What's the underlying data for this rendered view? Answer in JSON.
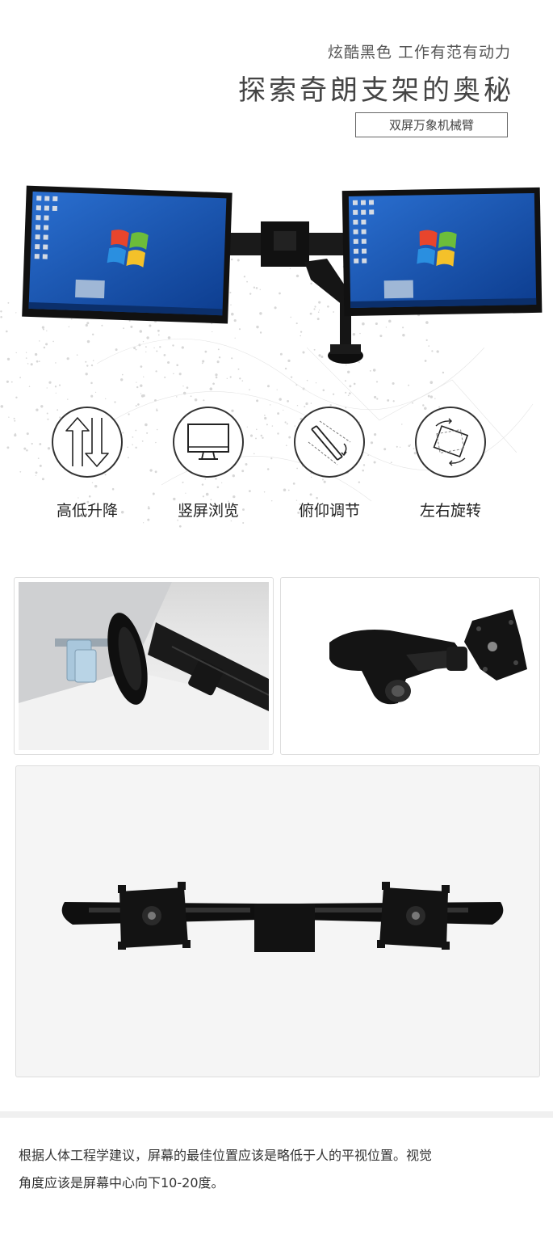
{
  "header": {
    "subtitle": "炫酷黑色 工作有范有动力",
    "title": "探索奇朗支架的奥秘",
    "tag": "双屏万象机械臂"
  },
  "features": [
    {
      "icon": "up-down-arrows-icon",
      "label": "高低升降"
    },
    {
      "icon": "monitor-icon",
      "label": "竖屏浏览"
    },
    {
      "icon": "tilt-icon",
      "label": "俯仰调节"
    },
    {
      "icon": "rotate-icon",
      "label": "左右旋转"
    }
  ],
  "photos": [
    {
      "icon": "desk-clamp-pole-photo"
    },
    {
      "icon": "gas-spring-arm-photo"
    },
    {
      "icon": "dual-crossbar-photo"
    }
  ],
  "description": {
    "line1": "根据人体工程学建议，屏幕的最佳位置应该是略低于人的平视位置。视觉",
    "line2": "角度应该是屏幕中心向下10-20度。"
  },
  "colors": {
    "accent": "#1f2a44",
    "screen": "#1c5fb8",
    "frame": "#111111"
  }
}
